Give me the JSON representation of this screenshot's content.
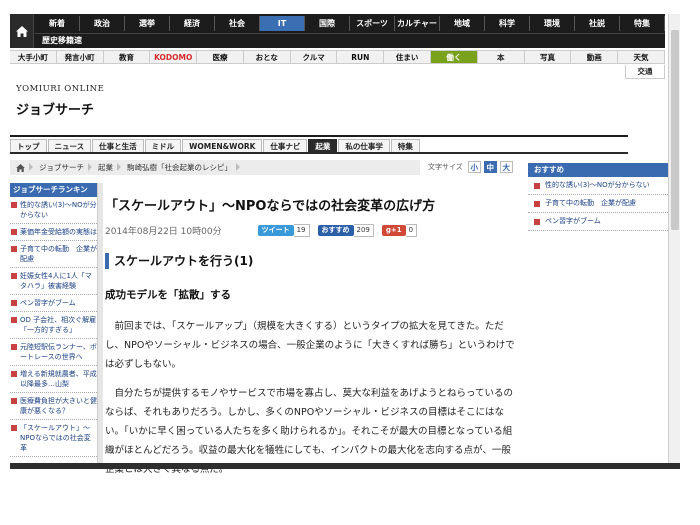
{
  "topnav": {
    "row1": [
      "新着",
      "政治",
      "選挙",
      "経済",
      "社会",
      "IT",
      "国際",
      "スポーツ",
      "カルチャー",
      "地域",
      "科学",
      "環境",
      "社説",
      "特集"
    ],
    "active_index": 5,
    "row2_label": "歴史移籍速"
  },
  "subnav": {
    "items": [
      "大手小町",
      "発言小町",
      "教育",
      "KODOMO",
      "医療",
      "おとな",
      "クルマ",
      "RUN",
      "住まい",
      "働く",
      "本",
      "写真",
      "動画",
      "天気"
    ],
    "extra": "交通"
  },
  "brand": "YOMIURI ONLINE",
  "section_title": "ジョブサーチ",
  "tabs": {
    "items": [
      "トップ",
      "ニュース",
      "仕事と生活",
      "ミドル",
      "WOMEN&WORK",
      "仕事ナビ",
      "起業",
      "私の仕事学",
      "特集"
    ],
    "active_index": 6
  },
  "breadcrumb": [
    "ジョブサーチ",
    "起業",
    "駒崎弘樹「社会起業のレシピ」"
  ],
  "font_size": {
    "label": "文字サイズ",
    "options": [
      "小",
      "中",
      "大"
    ],
    "selected": "中"
  },
  "ranking": {
    "heading": "ジョブサーチランキン",
    "items": [
      "性的な誘い(3)〜NOが分からない",
      "薬価年金受給額の実態は",
      "子育て中の転勤　企業が配慮",
      "妊娠女性4人に1人「マタハラ」被害経験",
      "ペン習字がブーム",
      "ОD 子会社、相次ぐ解雇「一方的すぎる」",
      "元陸短駅伝ランナー、ボートレースの世界へ",
      "増える新規就農者、平成以降最多…山梨",
      "医療費負担が大きいと健康が悪くなる？",
      "「スケールアウト」〜NPOならではの社会変革"
    ]
  },
  "article": {
    "title": "「スケールアウト」〜NPOならではの社会変革の広げ方",
    "date": "2014年08月22日 10時00分",
    "share": {
      "tweet_label": "ツイート",
      "tweet_count": "19",
      "osusume_label": "おすすめ",
      "osusume_count": "209",
      "gplus_label": "g+1",
      "gplus_count": "0"
    },
    "sub_heading": "スケールアウトを行う(1)",
    "lead": "成功モデルを「拡散」する",
    "paragraphs": [
      "前回までは、「スケールアップ」（規模を大きくする）というタイプの拡大を見てきた。ただし、NPOやソーシャル・ビジネスの場合、一般企業のように「大きくすれば勝ち」というわけでは必ずしもない。",
      "自分たちが提供するモノやサービスで市場を寡占し、莫大な利益をあげようとねらっているのならば、それもありだろう。しかし、多くのNPOやソーシャル・ビジネスの目標はそこにはない。「いかに早く困っている人たちを多く助けられるか」。それこそが最大の目標となっている組織がほとんどだろう。収益の最大化を犠牲にしても、インパクトの最大化を志向する点が、一般企業とは大きく異なる点だ。"
    ]
  },
  "recommend": {
    "heading": "おすすめ",
    "items": [
      "性的な誘い(3)〜NOが分からない",
      "子育て中の転勤　企業が配慮",
      "ペン習字がブーム"
    ]
  },
  "colors": {
    "nav_dark": "#1c1c1c",
    "accent_blue": "#3a6bb0",
    "active_green": "#7aa11c",
    "kodomo_red": "#d52d2d",
    "twitter": "#3a9ad9",
    "gplus": "#d14836"
  }
}
